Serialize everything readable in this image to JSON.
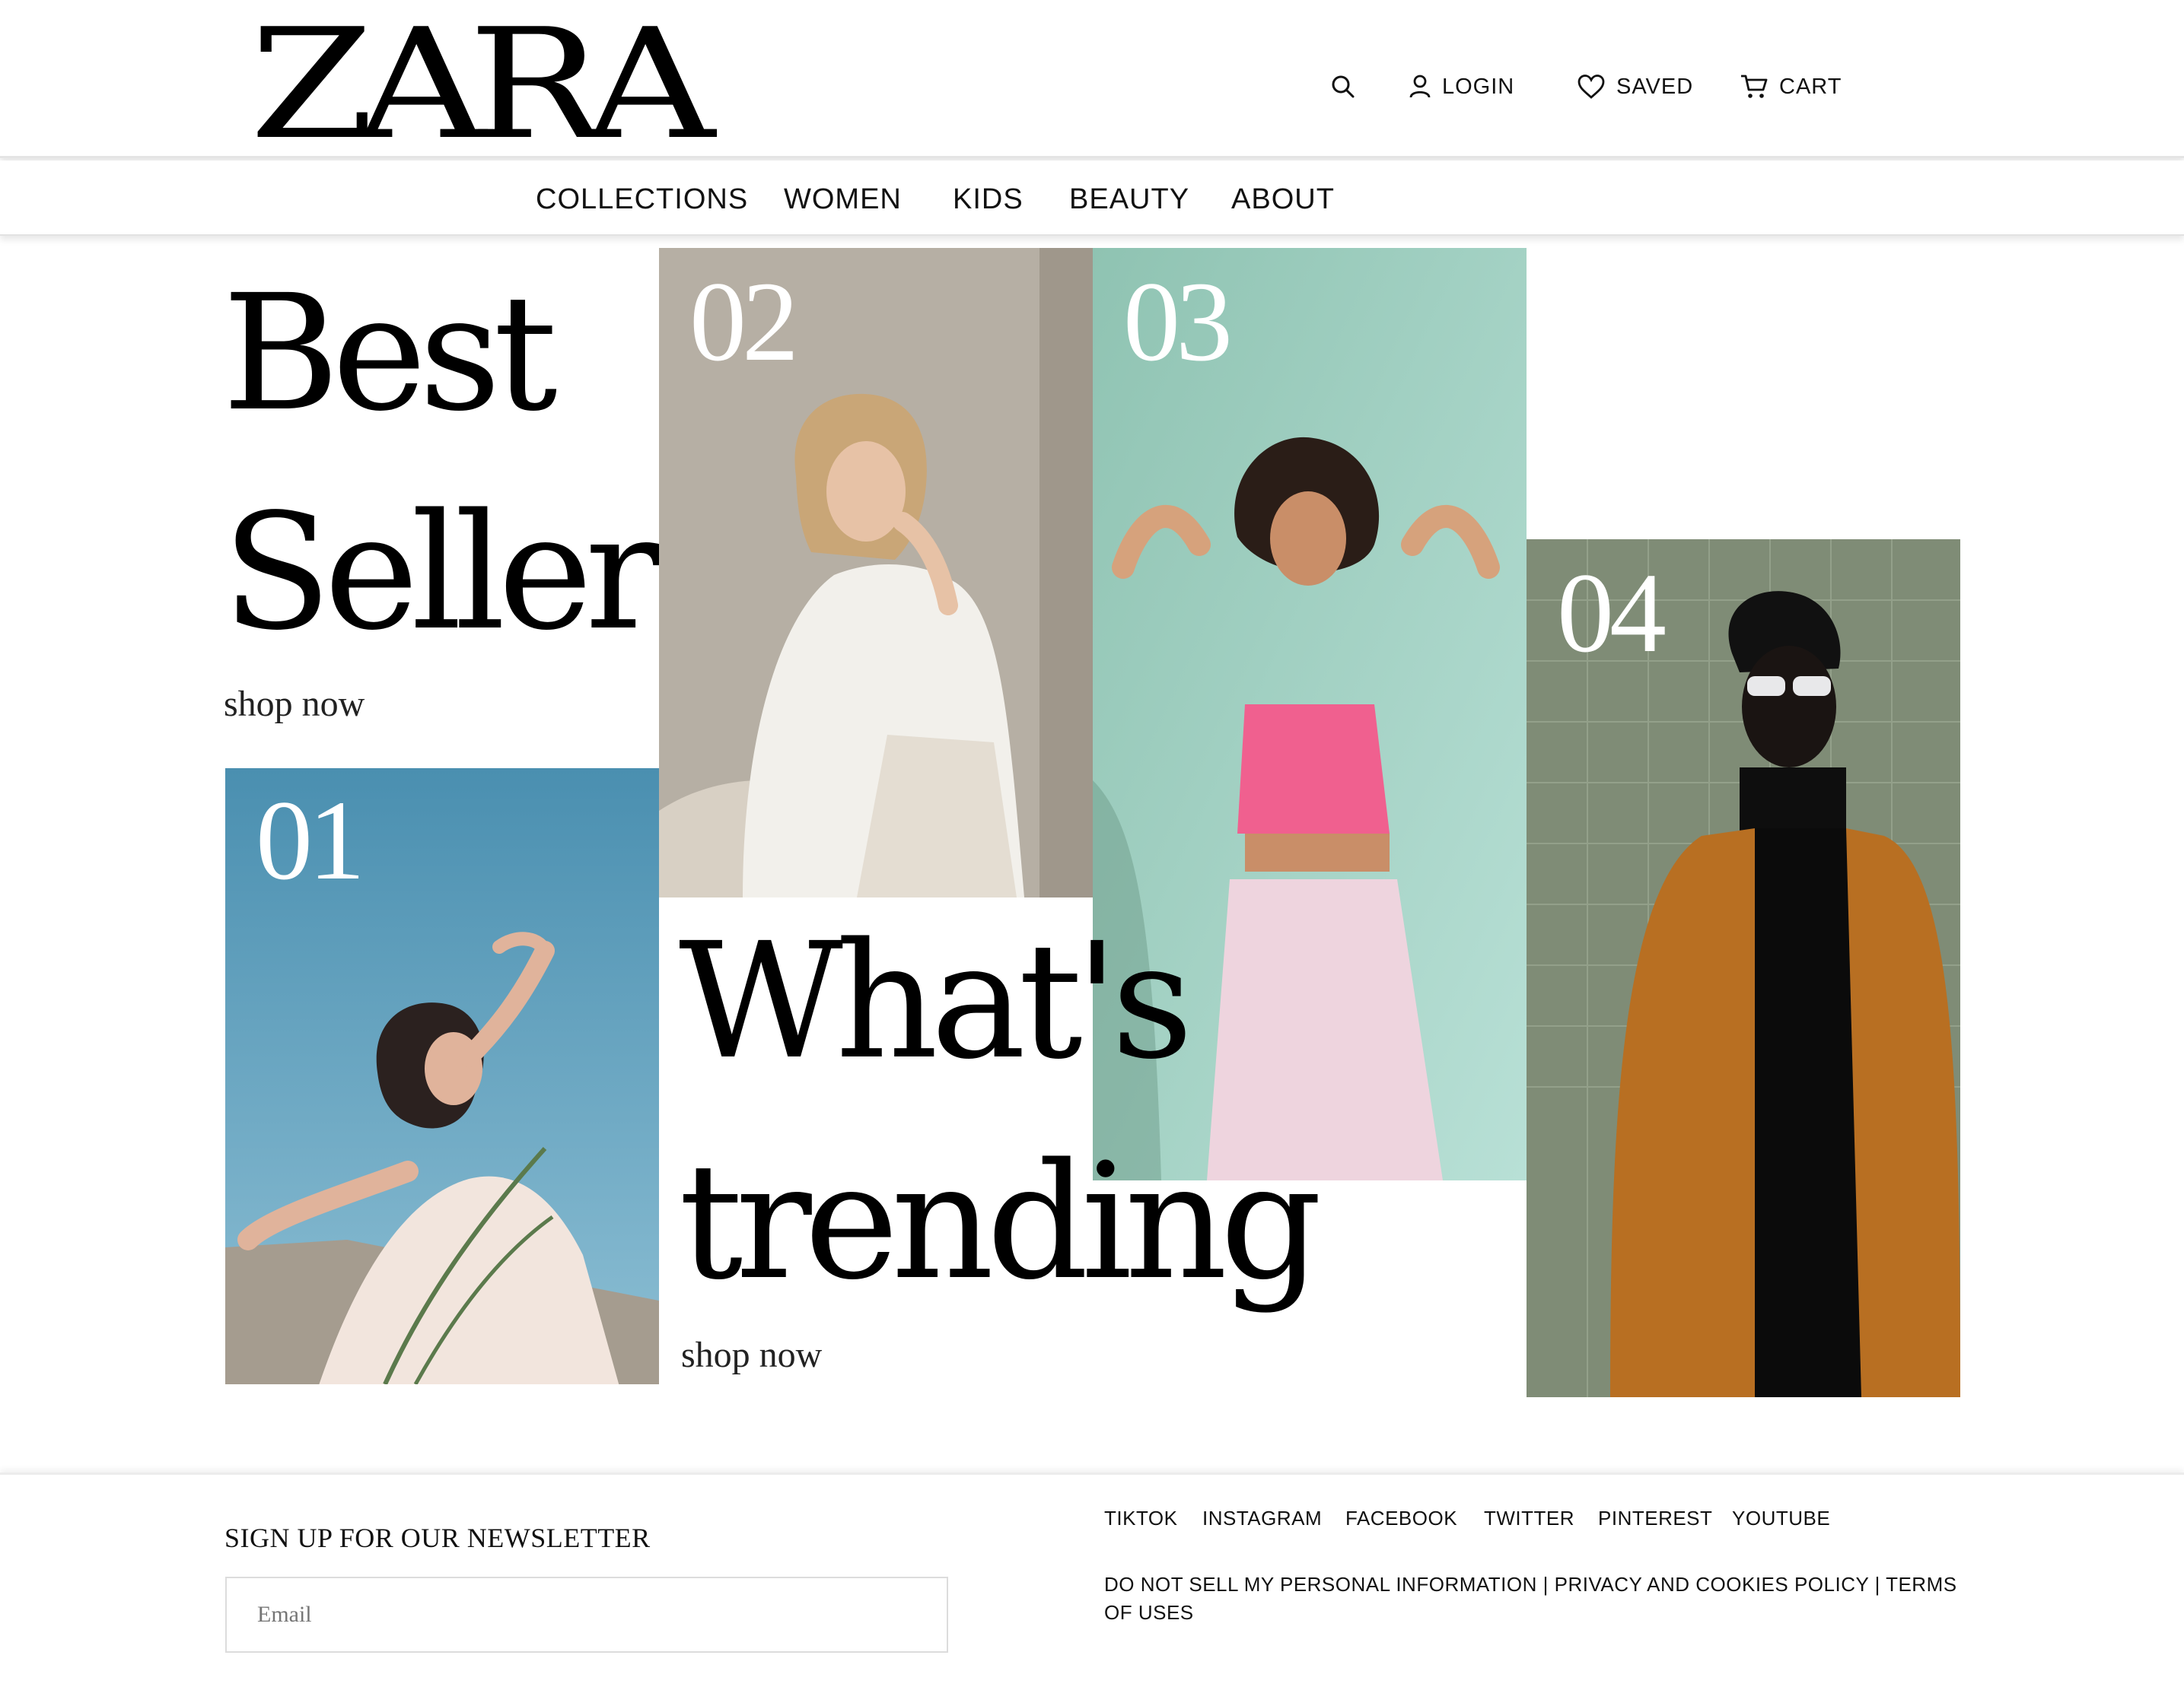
{
  "header": {
    "logo": "ZARA",
    "search_icon": "search-icon",
    "login_label": "LOGIN",
    "saved_label": "SAVED",
    "cart_label": "CART"
  },
  "nav": {
    "items": [
      {
        "label": "COLLECTIONS"
      },
      {
        "label": "WOMEN"
      },
      {
        "label": "KIDS"
      },
      {
        "label": "BEAUTY"
      },
      {
        "label": "ABOUT"
      }
    ]
  },
  "hero": {
    "best_word1": "Best",
    "best_word2": "Sellers",
    "best_cta": "shop now",
    "trending_word1": "What's",
    "trending_word2": "trending",
    "trending_cta": "shop now",
    "panels": [
      {
        "number": "01",
        "colors": {
          "sky": "#4f93b3",
          "ground": "#a89f93"
        }
      },
      {
        "number": "02",
        "colors": {
          "wall": "#b5ada2",
          "shirt": "#f3f1ec"
        }
      },
      {
        "number": "03",
        "colors": {
          "wall": "#9fcdbd",
          "top": "#f1628f",
          "pants": "#efd3dd"
        }
      },
      {
        "number": "04",
        "colors": {
          "wall": "#7d8a73",
          "jacket": "#b86f22"
        }
      }
    ]
  },
  "footer": {
    "newsletter_title": "SIGN UP FOR OUR NEWSLETTER",
    "email_placeholder": "Email",
    "social": [
      "TIKTOK",
      "INSTAGRAM",
      "FACEBOOK",
      "TWITTER",
      "PINTEREST",
      "YOUTUBE"
    ],
    "legal": "DO NOT SELL MY PERSONAL INFORMATION | PRIVACY AND COOKIES POLICY | TERMS OF USES"
  }
}
